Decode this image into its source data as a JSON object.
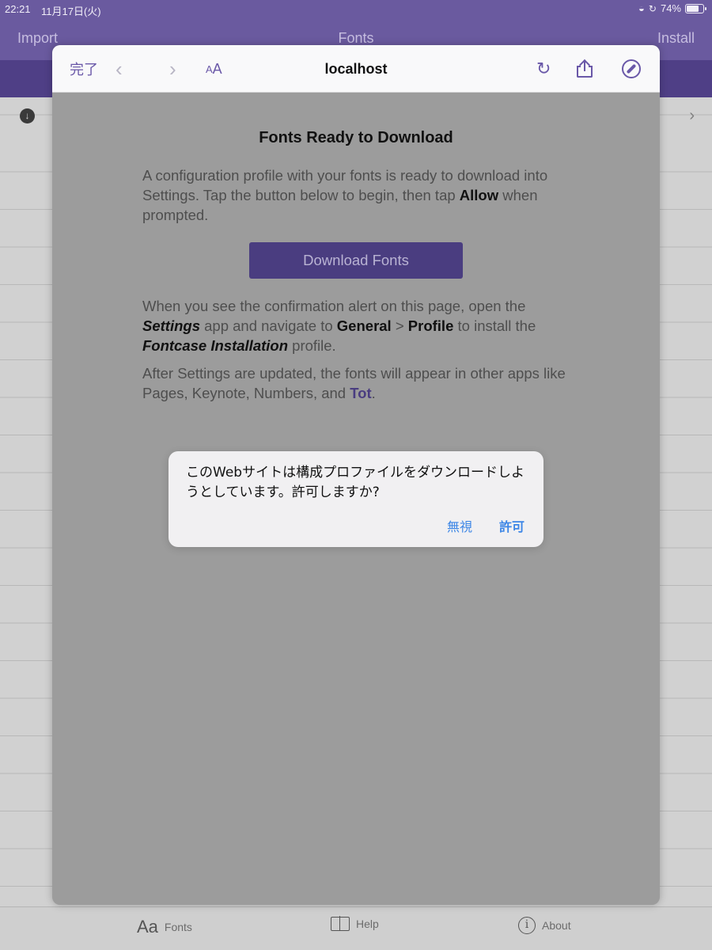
{
  "status_bar": {
    "time": "22:21",
    "date": "11月17日(火)",
    "battery": "74%",
    "battery_level": 0.74
  },
  "app_nav": {
    "import_label": "Import",
    "title": "Fonts",
    "install_label": "Install"
  },
  "tab_bar": {
    "fonts_icon": "Aa",
    "fonts_label": "Fonts",
    "help_label": "Help",
    "about_label": "About"
  },
  "browser": {
    "done_label": "完了",
    "text_size_label": "AA",
    "host": "localhost"
  },
  "page": {
    "heading": "Fonts Ready to Download",
    "intro_1": "A configuration profile with your fonts is ready to download into Settings. Tap the button below to begin, then tap ",
    "intro_allow": "Allow",
    "intro_2": " when prompted.",
    "button_label": "Download Fonts",
    "p2_1": "When you see the confirmation alert on this page, open the ",
    "p2_settings": "Settings",
    "p2_2": " app and navigate to ",
    "p2_general": "General",
    "p2_gt": " > ",
    "p2_profile": "Profile",
    "p2_3": " to install the ",
    "p2_fontcase": "Fontcase Installation",
    "p2_4": " profile.",
    "p3_1": "After Settings are updated, the fonts will appear in other apps like Pages, Keynote, Numbers, and ",
    "p3_tot": "Tot",
    "p3_2": "."
  },
  "alert": {
    "message": "このWebサイトは構成プロファイルをダウンロードしようとしています。許可しますか?",
    "ignore_label": "無視",
    "allow_label": "許可"
  },
  "colors": {
    "brand": "#6a5a9f",
    "accent": "#6a58a8",
    "button": "#4a3d80",
    "alert_link": "#3d86e6"
  }
}
